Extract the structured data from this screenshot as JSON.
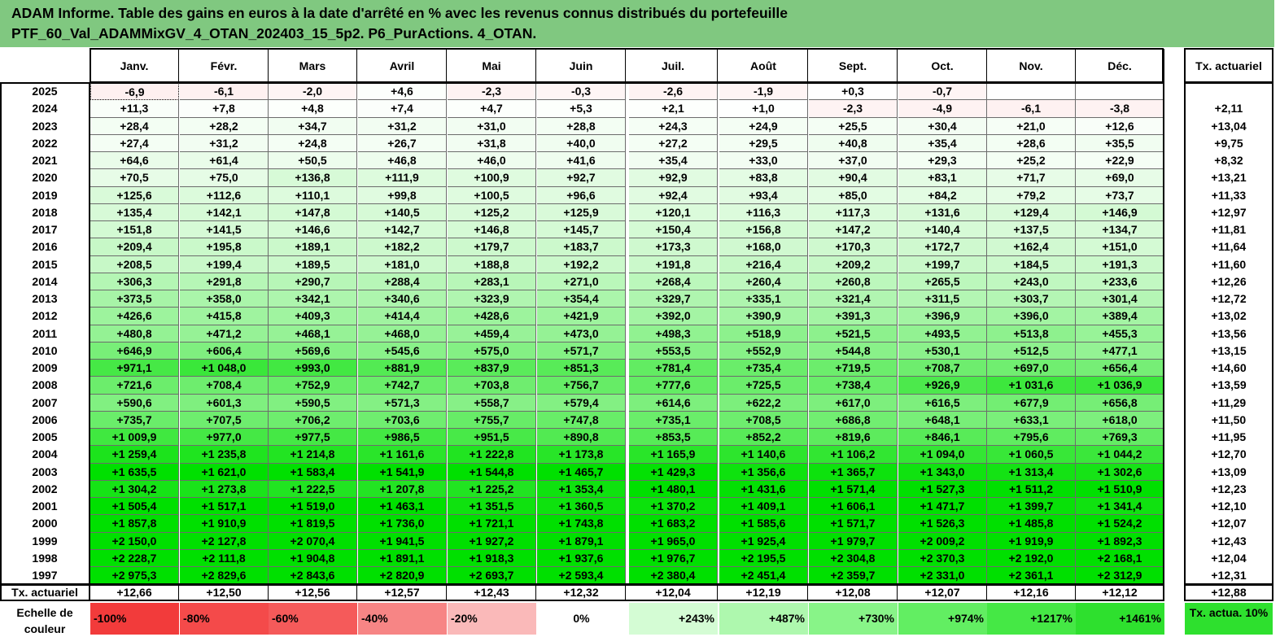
{
  "title": {
    "line1": "ADAM Informe. Table des gains en euros à la date d'arrêté en % avec les revenus connus distribués du portefeuille",
    "line2": "PTF_60_Val_ADAMMixGV_4_OTAN_202403_15_5p2. P6_PurActions. 4_OTAN."
  },
  "chart_data": {
    "type": "heatmap",
    "months": [
      "Janv.",
      "Févr.",
      "Mars",
      "Avril",
      "Mai",
      "Juin",
      "Juil.",
      "Août",
      "Sept.",
      "Oct.",
      "Nov.",
      "Déc."
    ],
    "rate_header": "Tx. actuariel",
    "rows": [
      {
        "year": "2025",
        "values": [
          "-6,9",
          "-6,1",
          "-2,0",
          "+4,6",
          "-2,3",
          "-0,3",
          "-2,6",
          "-1,9",
          "+0,3",
          "-0,7",
          "",
          ""
        ],
        "rate": ""
      },
      {
        "year": "2024",
        "values": [
          "+11,3",
          "+7,8",
          "+4,8",
          "+7,4",
          "+4,7",
          "+5,3",
          "+2,1",
          "+1,0",
          "-2,3",
          "-4,9",
          "-6,1",
          "-3,8"
        ],
        "rate": "+2,11"
      },
      {
        "year": "2023",
        "values": [
          "+28,4",
          "+28,2",
          "+34,7",
          "+31,2",
          "+31,0",
          "+28,8",
          "+24,3",
          "+24,9",
          "+25,5",
          "+30,4",
          "+21,0",
          "+12,6"
        ],
        "rate": "+13,04"
      },
      {
        "year": "2022",
        "values": [
          "+27,4",
          "+31,2",
          "+24,8",
          "+26,7",
          "+31,8",
          "+40,0",
          "+27,2",
          "+29,5",
          "+40,8",
          "+35,4",
          "+28,6",
          "+35,5"
        ],
        "rate": "+9,75"
      },
      {
        "year": "2021",
        "values": [
          "+64,6",
          "+61,4",
          "+50,5",
          "+46,8",
          "+46,0",
          "+41,6",
          "+35,4",
          "+33,0",
          "+37,0",
          "+29,3",
          "+25,2",
          "+22,9"
        ],
        "rate": "+8,32"
      },
      {
        "year": "2020",
        "values": [
          "+70,5",
          "+75,0",
          "+136,8",
          "+111,9",
          "+100,9",
          "+92,7",
          "+92,9",
          "+83,8",
          "+90,4",
          "+83,1",
          "+71,7",
          "+69,0"
        ],
        "rate": "+13,21"
      },
      {
        "year": "2019",
        "values": [
          "+125,6",
          "+112,6",
          "+110,1",
          "+99,8",
          "+100,5",
          "+96,6",
          "+92,4",
          "+93,4",
          "+85,0",
          "+84,2",
          "+79,2",
          "+73,7"
        ],
        "rate": "+11,33"
      },
      {
        "year": "2018",
        "values": [
          "+135,4",
          "+142,1",
          "+147,8",
          "+140,5",
          "+125,2",
          "+125,9",
          "+120,1",
          "+116,3",
          "+117,3",
          "+131,6",
          "+129,4",
          "+146,9"
        ],
        "rate": "+12,97"
      },
      {
        "year": "2017",
        "values": [
          "+151,8",
          "+141,5",
          "+146,6",
          "+142,7",
          "+146,8",
          "+145,7",
          "+150,4",
          "+156,8",
          "+147,2",
          "+140,4",
          "+137,5",
          "+134,7"
        ],
        "rate": "+11,81"
      },
      {
        "year": "2016",
        "values": [
          "+209,4",
          "+195,8",
          "+189,1",
          "+182,2",
          "+179,7",
          "+183,7",
          "+173,3",
          "+168,0",
          "+170,3",
          "+172,7",
          "+162,4",
          "+151,0"
        ],
        "rate": "+11,64"
      },
      {
        "year": "2015",
        "values": [
          "+208,5",
          "+199,4",
          "+189,5",
          "+181,0",
          "+188,8",
          "+192,2",
          "+191,8",
          "+216,4",
          "+209,2",
          "+199,7",
          "+184,5",
          "+191,3"
        ],
        "rate": "+11,60"
      },
      {
        "year": "2014",
        "values": [
          "+306,3",
          "+291,8",
          "+290,7",
          "+288,4",
          "+283,1",
          "+271,0",
          "+268,4",
          "+260,4",
          "+260,8",
          "+265,5",
          "+243,0",
          "+233,6"
        ],
        "rate": "+12,26"
      },
      {
        "year": "2013",
        "values": [
          "+373,5",
          "+358,0",
          "+342,1",
          "+340,6",
          "+323,9",
          "+354,4",
          "+329,7",
          "+335,1",
          "+321,4",
          "+311,5",
          "+303,7",
          "+301,4"
        ],
        "rate": "+12,72"
      },
      {
        "year": "2012",
        "values": [
          "+426,6",
          "+415,8",
          "+409,3",
          "+414,4",
          "+428,6",
          "+421,9",
          "+392,0",
          "+390,9",
          "+391,3",
          "+396,9",
          "+396,0",
          "+389,4"
        ],
        "rate": "+13,02"
      },
      {
        "year": "2011",
        "values": [
          "+480,8",
          "+471,2",
          "+468,1",
          "+468,0",
          "+459,4",
          "+473,0",
          "+498,3",
          "+518,9",
          "+521,5",
          "+493,5",
          "+513,8",
          "+455,3"
        ],
        "rate": "+13,56"
      },
      {
        "year": "2010",
        "values": [
          "+646,9",
          "+606,4",
          "+569,6",
          "+545,6",
          "+575,0",
          "+571,7",
          "+553,5",
          "+552,9",
          "+544,8",
          "+530,1",
          "+512,5",
          "+477,1"
        ],
        "rate": "+13,15"
      },
      {
        "year": "2009",
        "values": [
          "+971,1",
          "+1 048,0",
          "+993,0",
          "+881,9",
          "+837,9",
          "+851,3",
          "+781,4",
          "+735,4",
          "+719,5",
          "+708,7",
          "+697,0",
          "+656,4"
        ],
        "rate": "+14,60"
      },
      {
        "year": "2008",
        "values": [
          "+721,6",
          "+708,4",
          "+752,9",
          "+742,7",
          "+703,8",
          "+756,7",
          "+777,6",
          "+725,5",
          "+738,4",
          "+926,9",
          "+1 031,6",
          "+1 036,9"
        ],
        "rate": "+13,59"
      },
      {
        "year": "2007",
        "values": [
          "+590,6",
          "+601,3",
          "+590,5",
          "+571,3",
          "+558,7",
          "+579,4",
          "+614,6",
          "+622,2",
          "+617,0",
          "+616,5",
          "+677,9",
          "+656,8"
        ],
        "rate": "+11,29"
      },
      {
        "year": "2006",
        "values": [
          "+735,7",
          "+707,5",
          "+706,2",
          "+703,6",
          "+755,7",
          "+747,8",
          "+735,1",
          "+708,5",
          "+686,8",
          "+648,1",
          "+633,1",
          "+618,0"
        ],
        "rate": "+11,50"
      },
      {
        "year": "2005",
        "values": [
          "+1 009,9",
          "+977,0",
          "+977,5",
          "+986,5",
          "+951,5",
          "+890,8",
          "+853,5",
          "+852,2",
          "+819,6",
          "+846,1",
          "+795,6",
          "+769,3"
        ],
        "rate": "+11,95"
      },
      {
        "year": "2004",
        "values": [
          "+1 259,4",
          "+1 235,8",
          "+1 214,8",
          "+1 161,6",
          "+1 222,8",
          "+1 173,8",
          "+1 165,9",
          "+1 140,6",
          "+1 106,2",
          "+1 094,0",
          "+1 060,5",
          "+1 044,2"
        ],
        "rate": "+12,70"
      },
      {
        "year": "2003",
        "values": [
          "+1 635,5",
          "+1 621,0",
          "+1 583,4",
          "+1 541,9",
          "+1 544,8",
          "+1 465,7",
          "+1 429,3",
          "+1 356,6",
          "+1 365,7",
          "+1 343,0",
          "+1 313,4",
          "+1 302,6"
        ],
        "rate": "+13,09"
      },
      {
        "year": "2002",
        "values": [
          "+1 304,2",
          "+1 273,8",
          "+1 222,5",
          "+1 207,8",
          "+1 225,2",
          "+1 353,4",
          "+1 480,1",
          "+1 431,6",
          "+1 571,4",
          "+1 527,3",
          "+1 511,2",
          "+1 510,9"
        ],
        "rate": "+12,23"
      },
      {
        "year": "2001",
        "values": [
          "+1 505,4",
          "+1 517,1",
          "+1 519,0",
          "+1 463,1",
          "+1 351,5",
          "+1 360,5",
          "+1 370,2",
          "+1 409,1",
          "+1 606,1",
          "+1 471,7",
          "+1 399,7",
          "+1 341,4"
        ],
        "rate": "+12,10"
      },
      {
        "year": "2000",
        "values": [
          "+1 857,8",
          "+1 910,9",
          "+1 819,5",
          "+1 736,0",
          "+1 721,1",
          "+1 743,8",
          "+1 683,2",
          "+1 585,6",
          "+1 571,7",
          "+1 526,3",
          "+1 485,8",
          "+1 524,2"
        ],
        "rate": "+12,07"
      },
      {
        "year": "1999",
        "values": [
          "+2 150,0",
          "+2 127,8",
          "+2 070,4",
          "+1 941,5",
          "+1 927,2",
          "+1 879,1",
          "+1 965,0",
          "+1 925,4",
          "+1 979,7",
          "+2 009,2",
          "+1 919,9",
          "+1 892,3"
        ],
        "rate": "+12,43"
      },
      {
        "year": "1998",
        "values": [
          "+2 228,7",
          "+2 111,8",
          "+1 904,8",
          "+1 891,1",
          "+1 918,3",
          "+1 937,6",
          "+1 976,7",
          "+2 195,5",
          "+2 304,8",
          "+2 370,3",
          "+2 192,0",
          "+2 168,1"
        ],
        "rate": "+12,04"
      },
      {
        "year": "1997",
        "values": [
          "+2 975,3",
          "+2 829,6",
          "+2 843,6",
          "+2 820,9",
          "+2 693,7",
          "+2 593,4",
          "+2 380,4",
          "+2 451,4",
          "+2 359,7",
          "+2 331,0",
          "+2 361,1",
          "+2 312,9"
        ],
        "rate": "+12,31"
      }
    ],
    "footer": {
      "label": "Tx. actuariel",
      "values": [
        "+12,66",
        "+12,50",
        "+12,56",
        "+12,57",
        "+12,43",
        "+12,32",
        "+12,04",
        "+12,19",
        "+12,08",
        "+12,07",
        "+12,16",
        "+12,12"
      ],
      "rate": "+12,88"
    },
    "scale": {
      "label": "Echelle de couleur",
      "items": [
        {
          "text": "-100%",
          "color": "#f23b3b"
        },
        {
          "text": "-80%",
          "color": "#f44a4a"
        },
        {
          "text": "-60%",
          "color": "#f55a5a"
        },
        {
          "text": "-40%",
          "color": "#f78585"
        },
        {
          "text": "-20%",
          "color": "#fab9b9"
        },
        {
          "text": "0%",
          "color": "#ffffff"
        },
        {
          "text": "+243%",
          "color": "#d4fcd4"
        },
        {
          "text": "+487%",
          "color": "#aef8ae"
        },
        {
          "text": "+730%",
          "color": "#88f488"
        },
        {
          "text": "+974%",
          "color": "#62ee62"
        },
        {
          "text": "+1217%",
          "color": "#45e845"
        },
        {
          "text": "+1461%",
          "color": "#2ee02e"
        }
      ],
      "rate_label": "Tx. actua. 10%",
      "rate_color": "#2ee02e"
    },
    "colors": {
      "title_bg": "#80c880",
      "neg_light": "#fde6e6",
      "pos_light": "#ffffff",
      "pos_strong": "#00e000"
    }
  }
}
